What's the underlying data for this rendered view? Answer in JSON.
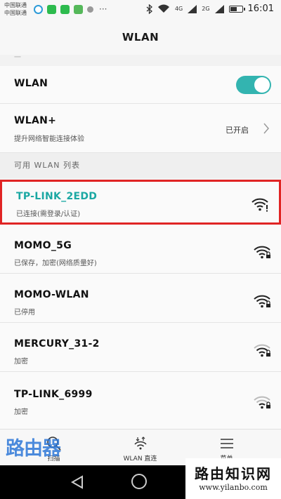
{
  "status_bar": {
    "carrier_1": "中国联通",
    "carrier_2": "中国联通",
    "network_1": "4G",
    "network_2": "2G",
    "time": "16:01",
    "battery_level": 0.65,
    "app_icons": [
      "browser-icon",
      "wechat-icon",
      "wechat-icon",
      "gallery-icon",
      "nfc-icon"
    ],
    "overflow": "···"
  },
  "header": {
    "title": "WLAN"
  },
  "wlan_toggle": {
    "label": "WLAN",
    "enabled": true,
    "color": "#33b4b0"
  },
  "wlan_plus": {
    "title": "WLAN+",
    "subtitle": "提升网络智能连接体验",
    "state": "已开启"
  },
  "available_section": {
    "label": "可用 WLAN 列表"
  },
  "networks": [
    {
      "ssid": "TP-LINK_2EDD",
      "status": "已连接(需登录/认证)",
      "connected": true,
      "secured": false,
      "signal": "wifi-warning-icon"
    },
    {
      "ssid": "MOMO_5G",
      "status": "已保存，加密(网络质量好)",
      "connected": false,
      "secured": true,
      "signal": "wifi-locked-icon"
    },
    {
      "ssid": "MOMO-WLAN",
      "status": "已停用",
      "connected": false,
      "secured": true,
      "signal": "wifi-locked-icon"
    },
    {
      "ssid": "MERCURY_31-2",
      "status": "加密",
      "connected": false,
      "secured": true,
      "signal": "wifi-locked-icon"
    },
    {
      "ssid": "TP-LINK_6999",
      "status": "加密",
      "connected": false,
      "secured": true,
      "signal": "wifi-locked-icon"
    }
  ],
  "toolbar": {
    "scan_label": "扫描",
    "direct_label": "WLAN 直连",
    "menu_label": "菜单"
  },
  "watermark": {
    "logo_text": "路由器",
    "site_title": "路由知识网",
    "site_url": "www.yilanbo.com"
  },
  "colors": {
    "accent": "#1ba8a3",
    "highlight": "#e02424"
  }
}
